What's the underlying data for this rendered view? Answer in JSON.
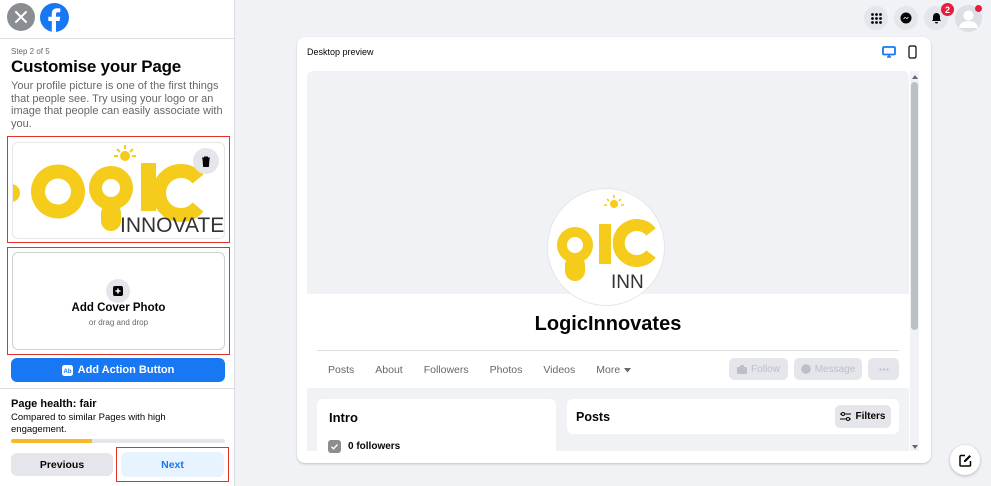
{
  "sidebar": {
    "step": "Step 2 of 5",
    "title": "Customise your Page",
    "description": "Your profile picture is one of the first things that people see. Try using your logo or an image that people can easily associate with you.",
    "profile_logo_text": "INNOVATE",
    "cover_title": "Add Cover Photo",
    "cover_subtitle": "or drag and drop",
    "action_button": "Add Action Button",
    "health_title": "Page health: fair",
    "health_desc": "Compared to similar Pages with high engagement.",
    "health_progress": 0.38,
    "previous": "Previous",
    "next": "Next"
  },
  "header": {
    "notifications_count": "2"
  },
  "preview": {
    "label": "Desktop preview",
    "page_name": "LogicInnovates",
    "avatar_text": "INN",
    "nav": [
      "Posts",
      "About",
      "Followers",
      "Photos",
      "Videos",
      "More"
    ],
    "follow": "Follow",
    "message": "Message",
    "intro_title": "Intro",
    "followers": "0 followers",
    "posts_title": "Posts",
    "filters": "Filters"
  },
  "colors": {
    "accent": "#1877f2",
    "logo_yellow": "#f5cb1c",
    "highlight_red": "#e0342b",
    "health_bar": "#f7b928"
  },
  "icons": [
    "close-icon",
    "facebook-icon",
    "trash-icon",
    "add-photo-icon",
    "ad-icon",
    "grid-menu-icon",
    "messenger-icon",
    "bell-icon",
    "profile-icon",
    "desktop-icon",
    "mobile-icon",
    "follow-icon",
    "message-icon",
    "more-icon",
    "filters-icon",
    "followers-icon",
    "compose-icon",
    "chevron-down-icon"
  ]
}
